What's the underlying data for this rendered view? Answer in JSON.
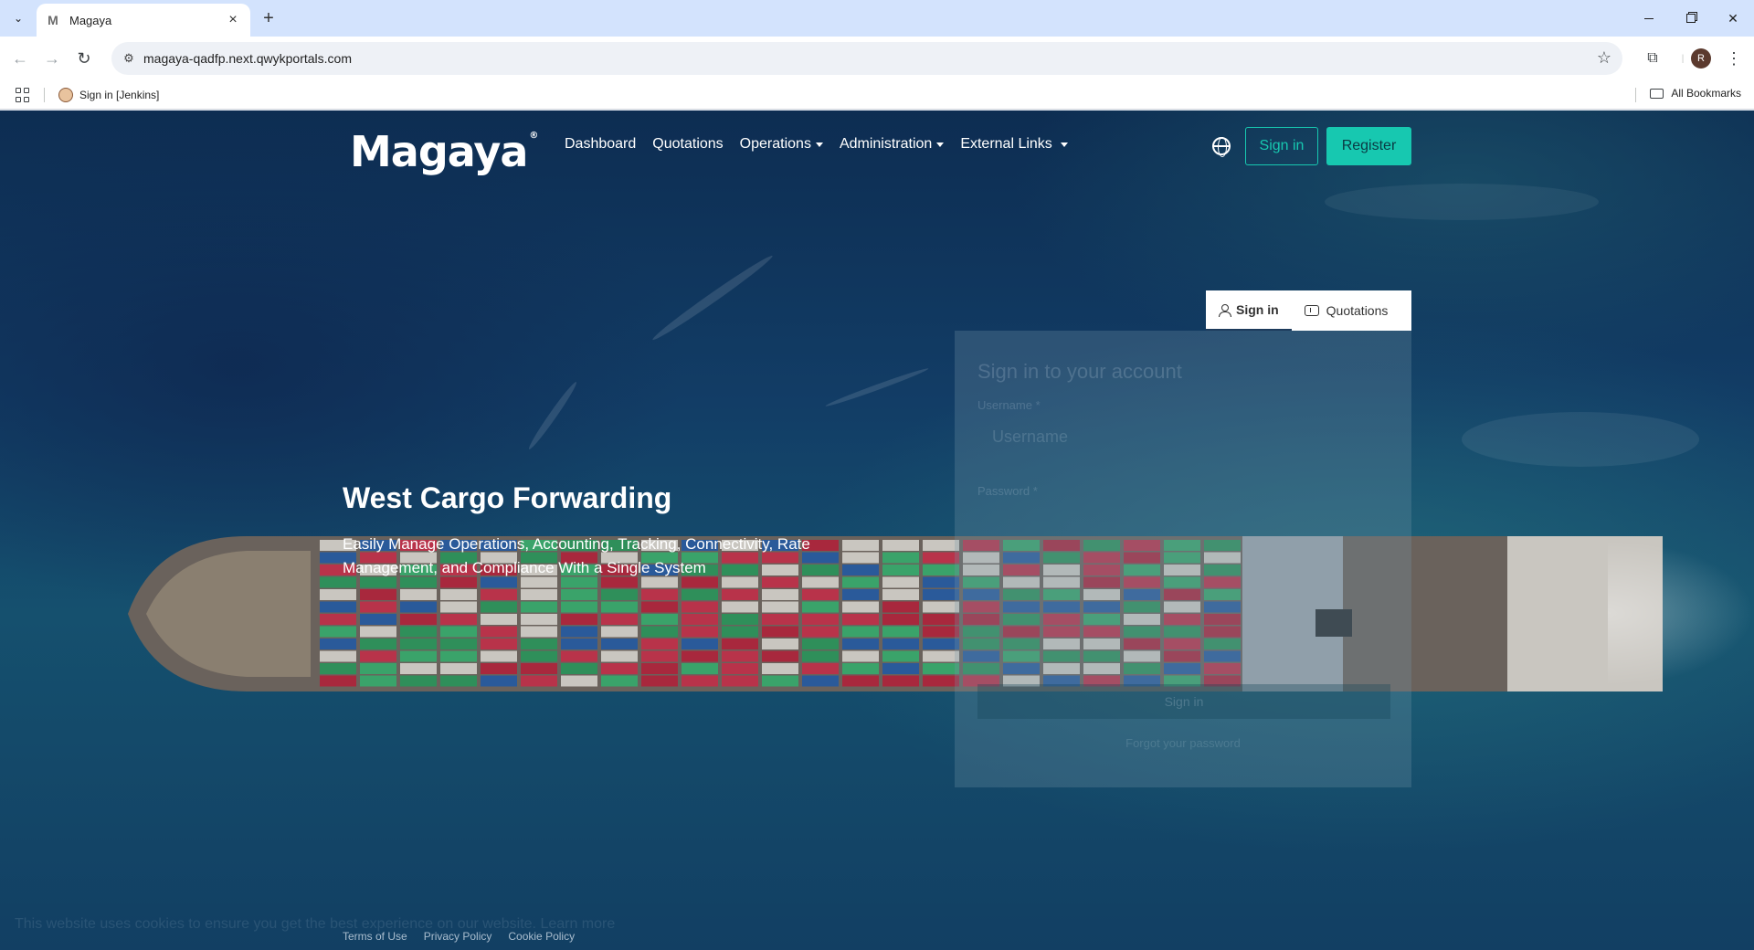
{
  "browser": {
    "tab_title": "Magaya",
    "tab_favicon": "M",
    "url": "magaya-qadfp.next.qwykportals.com",
    "profile_initial": "R",
    "bookmarks": [
      {
        "label": "Sign in [Jenkins]"
      }
    ],
    "all_bookmarks_label": "All Bookmarks"
  },
  "header": {
    "logo_text": "Magaya",
    "logo_mark": "®",
    "nav": [
      {
        "label": "Dashboard",
        "dropdown": false
      },
      {
        "label": "Quotations",
        "dropdown": false
      },
      {
        "label": "Operations",
        "dropdown": true
      },
      {
        "label": "Administration",
        "dropdown": true
      },
      {
        "label": "External Links",
        "dropdown": true
      }
    ],
    "signin_label": "Sign in",
    "register_label": "Register",
    "accent_color": "#17c8b0"
  },
  "hero": {
    "title": "West Cargo Forwarding",
    "subtitle": "Easily Manage Operations, Accounting, Tracking, Connectivity, Rate Management, and Compliance With a Single System"
  },
  "auth": {
    "tabs": [
      {
        "label": "Sign in",
        "icon": "user-icon",
        "active": true
      },
      {
        "label": "Quotations",
        "icon": "quotations-icon",
        "active": false
      }
    ],
    "panel_title": "Sign in to your account",
    "username_label": "Username *",
    "username_placeholder": "Username",
    "password_label": "Password *",
    "signin_button": "Sign in",
    "forgot_link": "Forgot your password"
  },
  "footer": {
    "cookie_text": "This website uses cookies to ensure you get the best experience on our website. Learn more",
    "links": [
      "Terms of Use",
      "Privacy Policy",
      "Cookie Policy"
    ]
  }
}
